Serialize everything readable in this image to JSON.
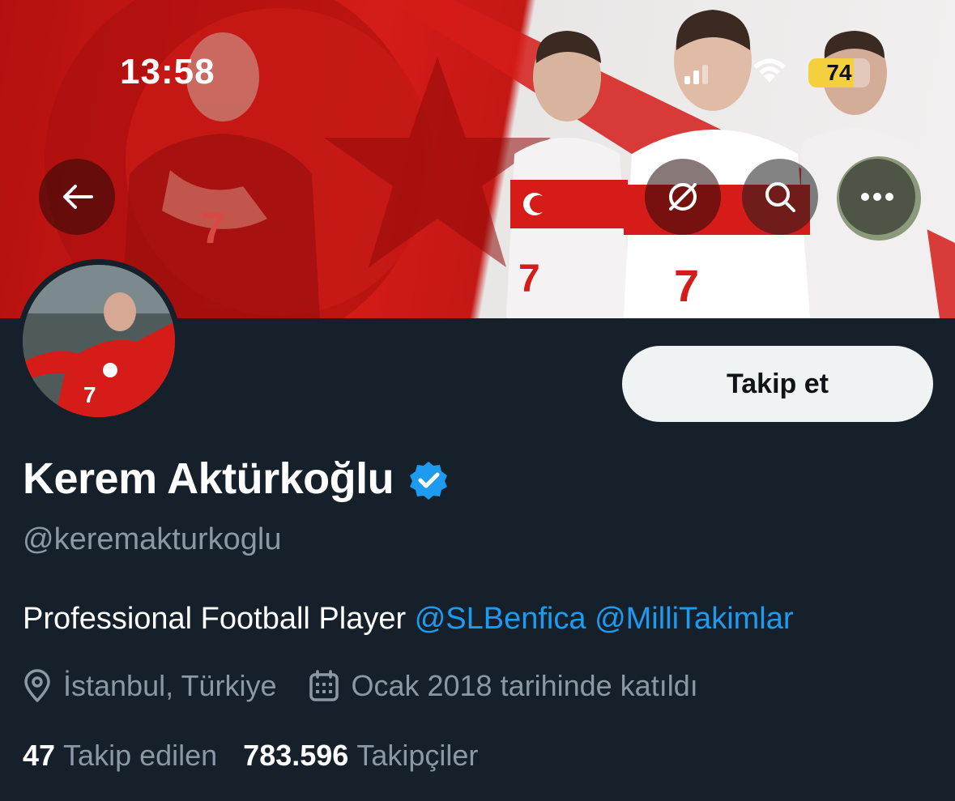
{
  "status_bar": {
    "time": "13:58",
    "battery_level": "74",
    "battery_fraction": 0.74
  },
  "header": {
    "back_icon": "arrow-left-icon",
    "action_icons": [
      "spaces-off-icon",
      "search-icon",
      "more-icon"
    ]
  },
  "profile": {
    "display_name": "Kerem Aktürkoğlu",
    "handle": "@keremakturkoglu",
    "bio_text": "Professional Football Player ",
    "bio_mentions": [
      "@SLBenfica",
      "@MilliTakimlar"
    ],
    "location": "İstanbul, Türkiye",
    "joined": "Ocak 2018 tarihinde katıldı",
    "following_count": "47",
    "following_label": "Takip edilen",
    "followers_count": "783.596",
    "followers_label": "Takipçiler",
    "follow_button": "Takip et"
  },
  "colors": {
    "background": "#15202b",
    "accent": "#1d9bf0",
    "secondary_text": "#8b98a5",
    "banner_red": "#d51c18"
  }
}
